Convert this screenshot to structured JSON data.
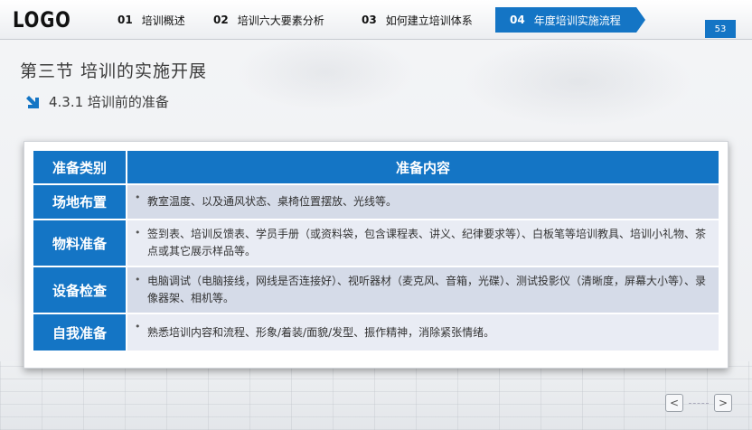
{
  "header": {
    "logo": "LOGO",
    "nav": [
      {
        "num": "01",
        "label": "培训概述"
      },
      {
        "num": "02",
        "label": "培训六大要素分析"
      },
      {
        "num": "03",
        "label": "如何建立培训体系"
      },
      {
        "num": "04",
        "label": "年度培训实施流程"
      }
    ],
    "page_number": "53"
  },
  "section_title": "第三节  培训的实施开展",
  "sub_title": "4.3.1 培训前的准备",
  "table": {
    "headers": [
      "准备类别",
      "准备内容"
    ],
    "rows": [
      {
        "category": "场地布置",
        "content": "教室温度、以及通风状态、桌椅位置摆放、光线等。"
      },
      {
        "category": "物料准备",
        "content": "签到表、培训反馈表、学员手册（或资料袋，包含课程表、讲义、纪律要求等）、白板笔等培训教具、培训小礼物、茶点或其它展示样品等。"
      },
      {
        "category": "设备检查",
        "content": "电脑调试（电脑接线，网线是否连接好）、视听器材（麦克风、音箱，光碟）、测试投影仪（清晰度，屏幕大小等）、录像器架、相机等。"
      },
      {
        "category": "自我准备",
        "content": "熟悉培训内容和流程、形象/着装/面貌/发型、振作精神，消除紧张情绪。"
      }
    ],
    "bullet": "•"
  },
  "pager": {
    "prev": "<",
    "next": ">"
  },
  "colors": {
    "accent": "#1475c5",
    "row_dark": "#d5dbe8",
    "row_light": "#e9ecf4"
  }
}
